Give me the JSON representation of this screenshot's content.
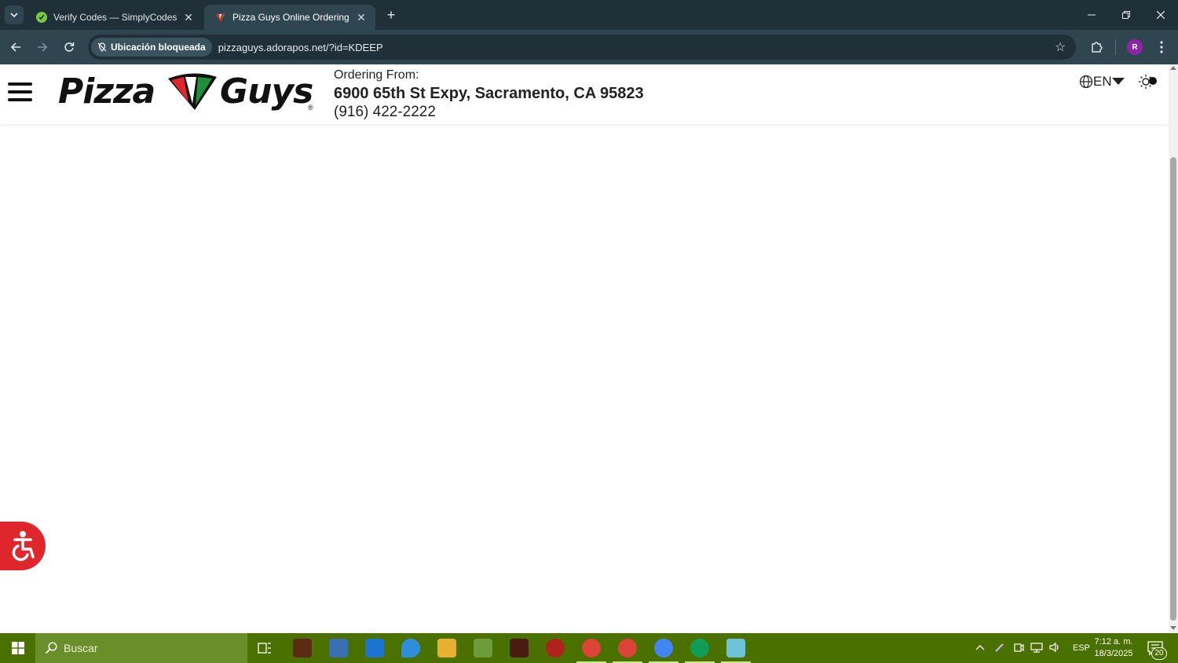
{
  "browser": {
    "tabs": [
      {
        "title": "Verify Codes — SimplyCodes",
        "active": false,
        "favicon": "simplycodes-icon"
      },
      {
        "title": "Pizza Guys Online Ordering",
        "active": true,
        "favicon": "pizzaguys-icon"
      }
    ],
    "site_chip": "Ubicación bloqueada",
    "url": "pizzaguys.adorapos.net/?id=KDEEP",
    "profile_initial": "R"
  },
  "header": {
    "logo_left": "Pizza",
    "logo_right": "Guys",
    "logo_reg": "®",
    "ordering_label": "Ordering From:",
    "address": "6900 65th St Expy, Sacramento, CA 95823",
    "phone": "(916) 422-2222",
    "language": "EN"
  },
  "taskbar": {
    "search_placeholder": "Buscar",
    "language": "ESP",
    "time": "7:12 a. m.",
    "date": "18/3/2025",
    "notifications": "20"
  },
  "colors": {
    "chrome_dark": "#1f3038",
    "chrome_light": "#2f4650",
    "brand_red": "#e0262d",
    "brand_green": "#1e8f3a",
    "taskbar": "#4a7000"
  }
}
